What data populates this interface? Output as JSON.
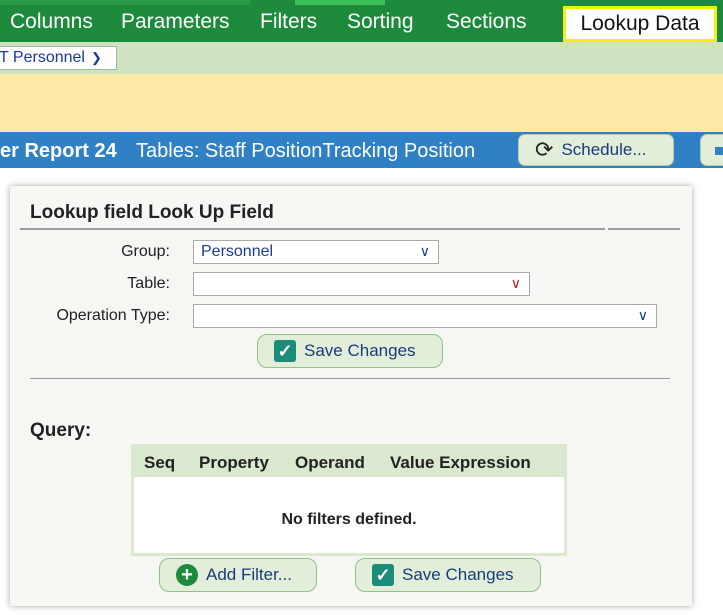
{
  "topnav": {
    "items": [
      "Columns",
      "Parameters",
      "Filters",
      "Sorting",
      "Sections"
    ],
    "active_tab": "Lookup Data"
  },
  "subbar": {
    "group_select": "T Personnel"
  },
  "reportbar": {
    "title": "er Report 24",
    "tables": "Tables: Staff PositionTracking Position",
    "schedule_button": "Schedule..."
  },
  "panel": {
    "title": "Lookup field Look Up Field",
    "group_label": "Group:",
    "group_value": "Personnel",
    "table_label": "Table:",
    "table_value": "",
    "operation_label": "Operation Type:",
    "operation_value": "",
    "save_changes_top": "Save Changes",
    "query_label": "Query:",
    "columns": [
      "Seq",
      "Property",
      "Operand",
      "Value Expression"
    ],
    "empty_message": "No filters defined.",
    "add_filter": "Add Filter...",
    "save_changes_bottom": "Save Changes"
  },
  "colors": {
    "nav_green": "#1e8b3c",
    "sub_green": "#cfe3c2",
    "yellow": "#fee9a6",
    "blue": "#2f80c5",
    "highlight": "#f3ee0a"
  }
}
